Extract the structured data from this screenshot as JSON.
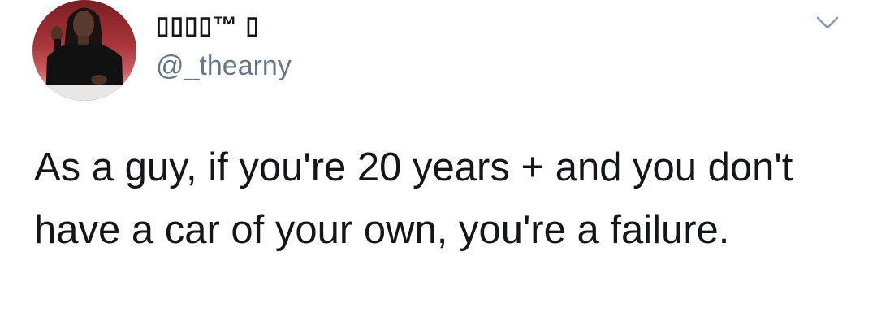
{
  "tweet": {
    "display_name": "▯▯▯▯™ ▯",
    "handle": "@_thearny",
    "text": "As a guy, if you're 20 years + and you don't have a car of your own, you're a failure.",
    "menu_icon": "chevron-down-icon",
    "avatar_icon": "profile-photo"
  },
  "colors": {
    "text": "#14171a",
    "handle": "#657786",
    "chevron": "#8899a6"
  }
}
